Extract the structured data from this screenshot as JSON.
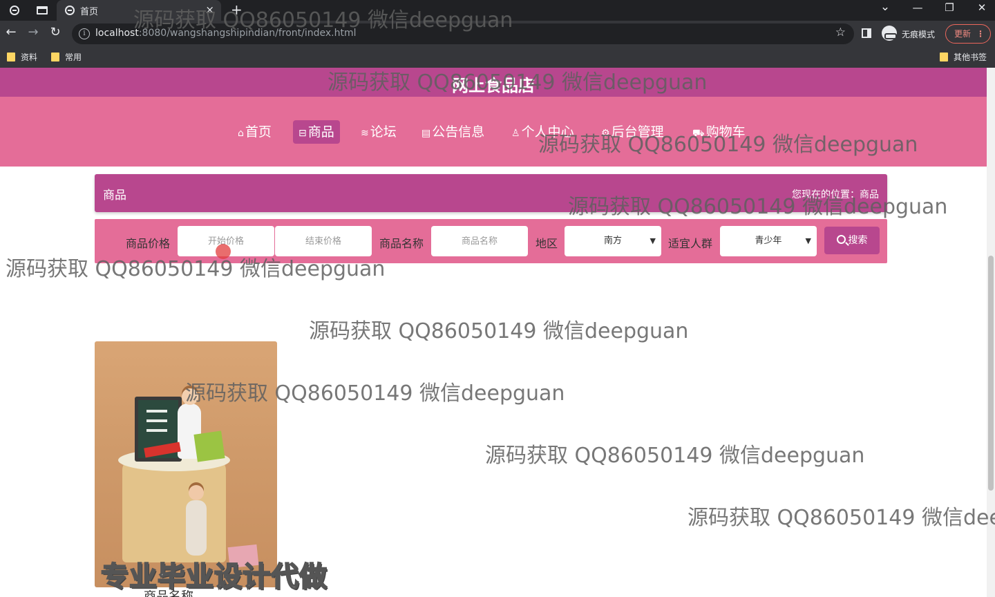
{
  "browser": {
    "tab_title": "首页",
    "tab_close": "×",
    "new_tab": "+",
    "window_controls": {
      "minimize": "—",
      "restore": "❐",
      "close": "✕",
      "tab_search": "⌄"
    },
    "nav": {
      "back": "←",
      "forward": "→",
      "reload": "↻"
    },
    "url_host": "localhost",
    "url_rest": ":8080/wangshangshipindian/front/index.html",
    "star": "☆",
    "incognito_label": "无痕模式",
    "update_label": "更新",
    "update_menu": "⋮",
    "bookmarks": [
      "资料",
      "常用"
    ],
    "other_bookmarks": "其他书签"
  },
  "site": {
    "title": "网上食品店",
    "nav": [
      {
        "icon": "⌂",
        "label": "首页"
      },
      {
        "icon": "⊟",
        "label": "商品"
      },
      {
        "icon": "≋",
        "label": "论坛"
      },
      {
        "icon": "▤",
        "label": "公告信息"
      },
      {
        "icon": "♙",
        "label": "个人中心"
      },
      {
        "icon": "⚙",
        "label": "后台管理"
      },
      {
        "icon": "⛟",
        "label": "购物车"
      }
    ],
    "active_nav": "商品"
  },
  "section": {
    "title": "商品",
    "breadcrumb": "您现在的位置：商品"
  },
  "search": {
    "price_label": "商品价格",
    "price_start_placeholder": "开始价格",
    "price_end_placeholder": "结束价格",
    "name_label": "商品名称",
    "name_placeholder": "商品名称",
    "region_label": "地区",
    "region_value": "南方",
    "crowd_label": "适宜人群",
    "crowd_value": "青少年",
    "button_label": "搜索"
  },
  "product": {
    "image_overlay_text": "专业毕业设计代做",
    "name": "商品名称"
  },
  "watermark": "源码获取 QQ86050149 微信deepguan",
  "colors": {
    "primary": "#b8478e",
    "nav_bg": "#e46d98",
    "chrome_dark": "#202124",
    "chrome_mid": "#35363a"
  }
}
